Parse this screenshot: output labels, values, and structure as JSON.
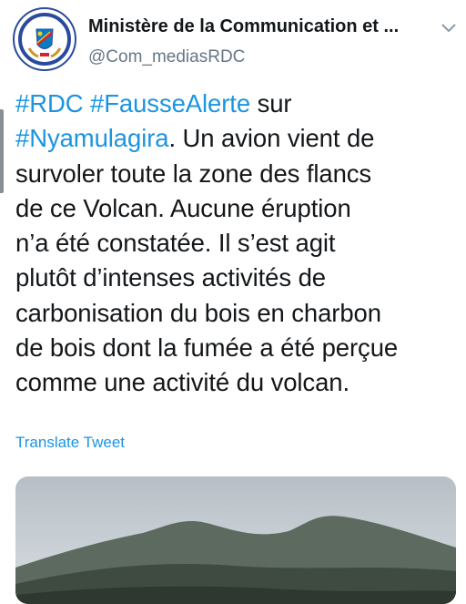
{
  "account": {
    "name": "Ministère de la Communication et ...",
    "handle": "@Com_mediasRDC",
    "avatar_icon": "ministry-seal-logo"
  },
  "tweet": {
    "lines": [
      [
        {
          "t": "#RDC",
          "tag": true
        },
        {
          "t": " "
        },
        {
          "t": "#FausseAlerte",
          "tag": true
        },
        {
          "t": " sur"
        }
      ],
      [
        {
          "t": "#Nyamulagira",
          "tag": true
        },
        {
          "t": ". Un avion vient de"
        }
      ],
      [
        {
          "t": "survoler toute la zone des flancs"
        }
      ],
      [
        {
          "t": "de ce Volcan. Aucune éruption"
        }
      ],
      [
        {
          "t": "n’a été constatée. Il s’est agit"
        }
      ],
      [
        {
          "t": "plutôt d’intenses activités de"
        }
      ],
      [
        {
          "t": "carbonisation du bois en charbon"
        }
      ],
      [
        {
          "t": "de bois dont la fumée a été perçue"
        }
      ],
      [
        {
          "t": "comme une activité du volcan."
        }
      ]
    ]
  },
  "translate_label": "Translate Tweet",
  "media": {
    "subject": "volcano-photo"
  },
  "colors": {
    "link": "#1b95e0",
    "text": "#14171a",
    "muted": "#657786"
  }
}
